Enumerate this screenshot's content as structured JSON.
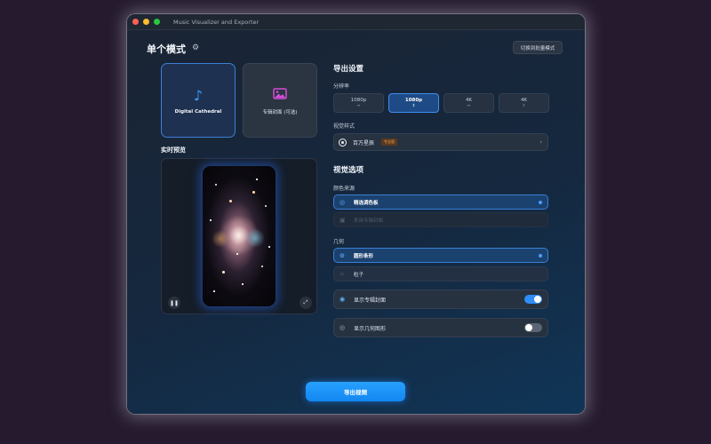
{
  "window": {
    "title": "Music Visualizer and Exporter"
  },
  "header": {
    "mode_title": "单个模式",
    "batch_button": "切换到批量模式"
  },
  "sources": [
    {
      "label": "Digital Cathedral",
      "icon": "music-note-icon",
      "selected": true
    },
    {
      "label": "专辑封面 (可选)",
      "icon": "image-icon",
      "selected": false
    }
  ],
  "preview": {
    "label": "实时预览"
  },
  "export_settings": {
    "title": "导出设置",
    "resolution_label": "分辨率",
    "resolutions": [
      {
        "label": "1080p",
        "sub": "↔",
        "selected": false
      },
      {
        "label": "1080p",
        "sub": "↕",
        "selected": true
      },
      {
        "label": "4K",
        "sub": "↔",
        "selected": false
      },
      {
        "label": "4K",
        "sub": "↕",
        "selected": false
      }
    ],
    "visual_style_label": "视觉样式",
    "visual_style_value": "百万星辰",
    "visual_style_badge": "专业版"
  },
  "visual_options": {
    "title": "视觉选项",
    "color_source_label": "颜色来源",
    "color_sources": [
      {
        "label": "精选调色板",
        "icon": "palette-icon",
        "state": "selected"
      },
      {
        "label": "来自专辑封面",
        "icon": "photo-icon",
        "state": "disabled"
      }
    ],
    "geometry_label": "几何",
    "geometry": [
      {
        "label": "圆形条形",
        "icon": "circle-bars-icon",
        "state": "selected"
      },
      {
        "label": "粒子",
        "icon": "sparkle-icon",
        "state": "normal"
      }
    ],
    "toggles": [
      {
        "label": "显示专辑封面",
        "icon": "album-icon",
        "on": true
      },
      {
        "label": "显示几何图形",
        "icon": "shape-icon",
        "on": false
      }
    ]
  },
  "footer": {
    "export_button": "导出视频"
  },
  "colors": {
    "accent": "#2f8df5",
    "background": "#251a2e",
    "badge": "#f5a14b"
  }
}
